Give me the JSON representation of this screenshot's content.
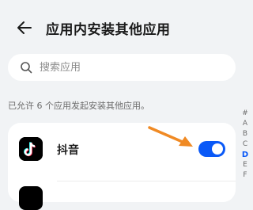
{
  "header": {
    "title": "应用内安装其他应用",
    "back_icon": "arrow-left-icon"
  },
  "search": {
    "placeholder": "搜索应用",
    "value": "",
    "icon": "search-icon"
  },
  "note": "已允许 6 个应用发起安装其他应用。",
  "apps": [
    {
      "name": "抖音",
      "icon": "douyin-app-icon",
      "allowed": true
    },
    {
      "name": "",
      "icon": "app-icon",
      "allowed": null
    }
  ],
  "index_bar": {
    "letters": [
      "#",
      "A",
      "B",
      "C",
      "D",
      "E",
      "F"
    ],
    "active": "D"
  },
  "colors": {
    "accent": "#0a59f7",
    "annotation_arrow": "#f08a24"
  }
}
